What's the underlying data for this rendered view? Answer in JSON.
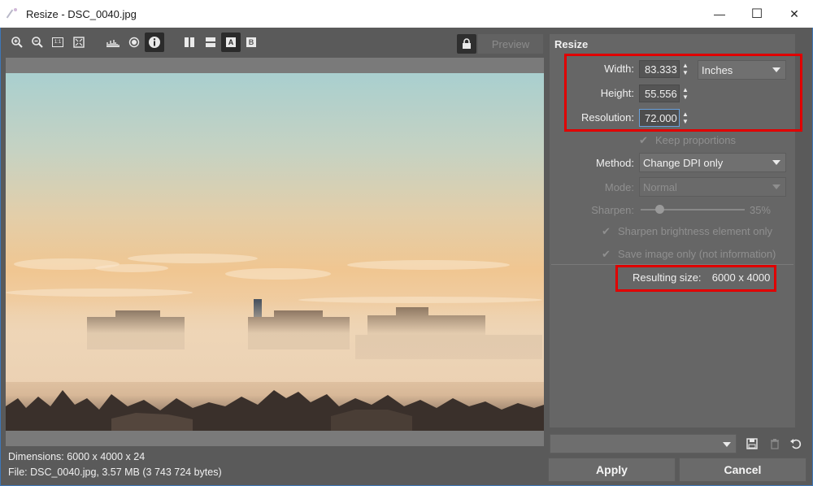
{
  "window": {
    "title": "Resize - DSC_0040.jpg",
    "minimize_glyph": "—",
    "maximize_glyph": "☐",
    "close_glyph": "✕"
  },
  "toolbar": {
    "icons": [
      "zoom-in-icon",
      "zoom-out-icon",
      "zoom-1-1-icon",
      "zoom-fit-icon",
      "histogram-icon",
      "circle-icon",
      "info-icon",
      "split-vertical-icon",
      "split-horizontal-icon",
      "view-a-icon",
      "view-b-icon"
    ],
    "zoom_1_1_label": "1:1",
    "view_a_label": "A",
    "view_b_label": "B",
    "preview_label": "Preview"
  },
  "status": {
    "dimensions": "Dimensions: 6000 x 4000 x 24",
    "file": "File: DSC_0040.jpg, 3.57 MB (3 743 724 bytes)"
  },
  "panel": {
    "title": "Resize",
    "width_label": "Width:",
    "width_value": "83.333",
    "unit_value": "Inches",
    "height_label": "Height:",
    "height_value": "55.556",
    "resolution_label": "Resolution:",
    "resolution_value": "72.000",
    "keep_proportions": "Keep proportions",
    "method_label": "Method:",
    "method_value": "Change DPI only",
    "mode_label": "Mode:",
    "mode_value": "Normal",
    "sharpen_label": "Sharpen:",
    "sharpen_value": "35%",
    "sharpen_level_fraction": 0.35,
    "sharpen_brightness": "Sharpen brightness element only",
    "save_image_only": "Save image only (not information)",
    "resulting_size_label": "Resulting size:",
    "resulting_size_value": "6000 x 4000"
  },
  "footer": {
    "apply_label": "Apply",
    "cancel_label": "Cancel"
  },
  "colors": {
    "highlight": "#e00000",
    "panel_bg": "#666666",
    "window_bg": "#5a5a5a"
  }
}
